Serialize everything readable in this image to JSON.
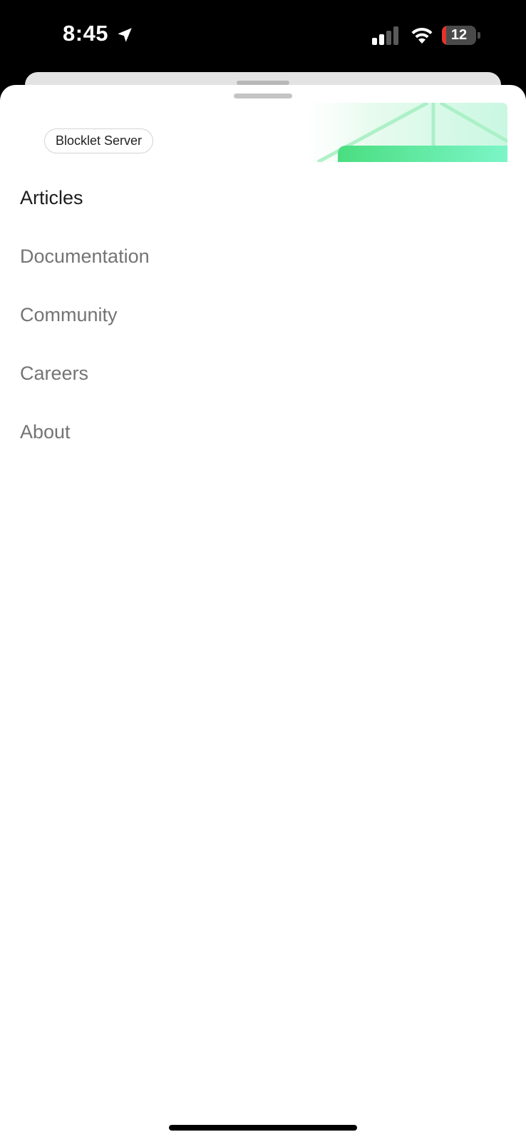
{
  "status_bar": {
    "time": "8:45",
    "battery_level": "12",
    "battery_fraction": 0.12,
    "icons": [
      "location-arrow-icon",
      "cellular-signal-icon",
      "wifi-icon",
      "battery-icon"
    ]
  },
  "banner": {
    "badge_label": "Blocklet Server",
    "accent_color": "#4ade80"
  },
  "nav": {
    "items": [
      {
        "label": "Articles",
        "active": true
      },
      {
        "label": "Documentation",
        "active": false
      },
      {
        "label": "Community",
        "active": false
      },
      {
        "label": "Careers",
        "active": false
      },
      {
        "label": "About",
        "active": false
      }
    ]
  },
  "colors": {
    "active_text": "#1d1d1d",
    "inactive_text": "#747474",
    "battery_low": "#e5322d"
  }
}
